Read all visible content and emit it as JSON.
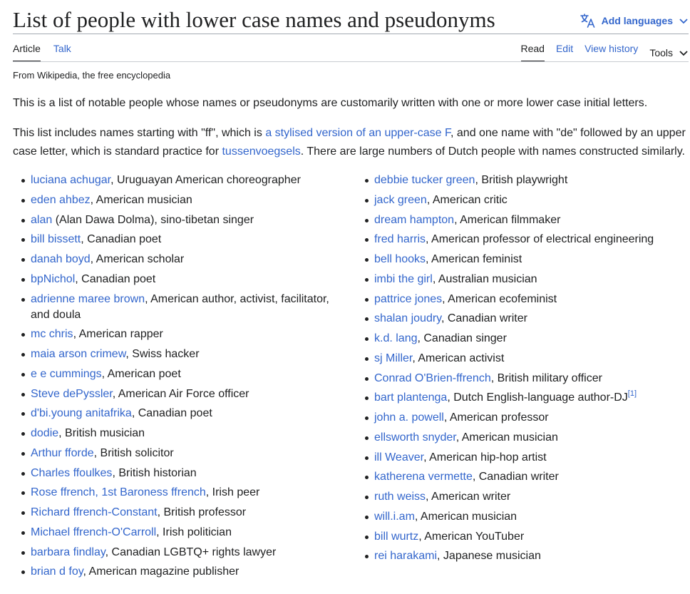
{
  "header": {
    "title": "List of people with lower case names and pseudonyms",
    "add_languages": "Add languages"
  },
  "tabs": {
    "article": "Article",
    "talk": "Talk",
    "read": "Read",
    "edit": "Edit",
    "view_history": "View history",
    "tools": "Tools"
  },
  "tagline": "From Wikipedia, the free encyclopedia",
  "intro": {
    "p1": "This is a list of notable people whose names or pseudonyms are customarily written with one or more lower case initial letters.",
    "p2_a": "This list includes names starting with \"ff\", which is ",
    "p2_link1": "a stylised version of an upper-case F",
    "p2_b": ", and one name with \"de\" followed by an upper case letter, which is standard practice for ",
    "p2_link2": "tussenvoegsels",
    "p2_c": ". There are large numbers of Dutch people with names constructed similarly."
  },
  "left_list": [
    {
      "name": "luciana achugar",
      "desc": ", Uruguayan American choreographer"
    },
    {
      "name": "eden ahbez",
      "desc": ", American musician"
    },
    {
      "name": "alan",
      "desc": " (Alan Dawa Dolma), sino-tibetan singer"
    },
    {
      "name": "bill bissett",
      "desc": ", Canadian poet"
    },
    {
      "name": "danah boyd",
      "desc": ", American scholar"
    },
    {
      "name": "bpNichol",
      "desc": ", Canadian poet"
    },
    {
      "name": "adrienne maree brown",
      "desc": ", American author, activist, facilitator, and doula"
    },
    {
      "name": "mc chris",
      "desc": ", American rapper"
    },
    {
      "name": "maia arson crimew",
      "desc": ", Swiss hacker"
    },
    {
      "name": "e e cummings",
      "desc": ", American poet"
    },
    {
      "name": "Steve dePyssler",
      "desc": ", American Air Force officer"
    },
    {
      "name": "d'bi.young anitafrika",
      "desc": ", Canadian poet"
    },
    {
      "name": "dodie",
      "desc": ", British musician"
    },
    {
      "name": "Arthur fforde",
      "desc": ", British solicitor"
    },
    {
      "name": "Charles ffoulkes",
      "desc": ", British historian"
    },
    {
      "name": "Rose ffrench, 1st Baroness ffrench",
      "desc": ", Irish peer"
    },
    {
      "name": "Richard ffrench-Constant",
      "desc": ", British professor"
    },
    {
      "name": "Michael ffrench-O'Carroll",
      "desc": ", Irish politician"
    },
    {
      "name": "barbara findlay",
      "desc": ", Canadian LGBTQ+ rights lawyer"
    },
    {
      "name": "brian d foy",
      "desc": ", American magazine publisher"
    }
  ],
  "right_list": [
    {
      "name": "debbie tucker green",
      "desc": ", British playwright"
    },
    {
      "name": "jack green",
      "desc": ", American critic"
    },
    {
      "name": "dream hampton",
      "desc": ", American filmmaker"
    },
    {
      "name": "fred harris",
      "desc": ", American professor of electrical engineering"
    },
    {
      "name": "bell hooks",
      "desc": ", American feminist"
    },
    {
      "name": "imbi the girl",
      "desc": ", Australian musician"
    },
    {
      "name": "pattrice jones",
      "desc": ", American ecofeminist"
    },
    {
      "name": "shalan joudry",
      "desc": ", Canadian writer"
    },
    {
      "name": "k.d. lang",
      "desc": ", Canadian singer"
    },
    {
      "name": "sj Miller",
      "desc": ", American activist"
    },
    {
      "name": "Conrad O'Brien-ffrench",
      "desc": ", British military officer"
    },
    {
      "name": "bart plantenga",
      "desc": ", Dutch English-language author-DJ",
      "ref": "[1]"
    },
    {
      "name": "john a. powell",
      "desc": ", American professor"
    },
    {
      "name": "ellsworth snyder",
      "desc": ", American musician"
    },
    {
      "name": "ill Weaver",
      "desc": ", American hip-hop artist"
    },
    {
      "name": "katherena vermette",
      "desc": ", Canadian writer"
    },
    {
      "name": "ruth weiss",
      "desc": ", American writer"
    },
    {
      "name": "will.i.am",
      "desc": ", American musician"
    },
    {
      "name": "bill wurtz",
      "desc": ", American YouTuber"
    },
    {
      "name": "rei harakami",
      "desc": ", Japanese musician"
    }
  ],
  "colors": {
    "link": "#3366cc",
    "text": "#202122",
    "rule": "#a2a9b1"
  },
  "icons": [
    "translate-icon",
    "chevron-down-icon"
  ]
}
